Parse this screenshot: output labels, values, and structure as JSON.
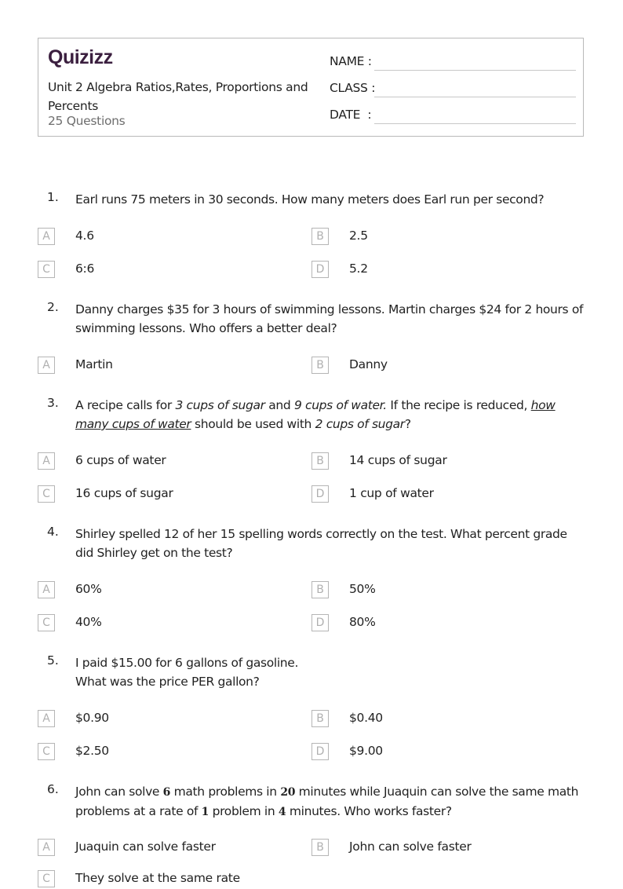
{
  "header": {
    "logo": "Quizizz",
    "title": "Unit 2 Algebra Ratios,Rates, Proportions and Percents",
    "question_count": "25 Questions",
    "fields": [
      {
        "label": "NAME :"
      },
      {
        "label": "CLASS :"
      },
      {
        "label": "DATE  :"
      }
    ]
  },
  "brand_color": "#3b1f3f",
  "questions": [
    {
      "number": "1.",
      "text": "Earl runs 75 meters in 30 seconds. How many meters does Earl run per second?",
      "options": [
        {
          "letter": "A",
          "text": "4.6"
        },
        {
          "letter": "B",
          "text": "2.5"
        },
        {
          "letter": "C",
          "text": "6:6"
        },
        {
          "letter": "D",
          "text": "5.2"
        }
      ]
    },
    {
      "number": "2.",
      "text": "Danny charges $35 for 3 hours of swimming lessons. Martin charges $24 for 2 hours of swimming lessons. Who offers a better deal?",
      "options": [
        {
          "letter": "A",
          "text": "Martin"
        },
        {
          "letter": "B",
          "text": "Danny"
        }
      ]
    },
    {
      "number": "3.",
      "text_parts": [
        {
          "t": "A recipe calls for ",
          "style": "normal"
        },
        {
          "t": "3 cups of sugar",
          "style": "italic"
        },
        {
          "t": " and ",
          "style": "normal"
        },
        {
          "t": "9 cups of water.",
          "style": "italic"
        },
        {
          "t": " If the recipe is reduced, ",
          "style": "normal"
        },
        {
          "t": "how many cups of water",
          "style": "italic-underline"
        },
        {
          "t": " should be used with ",
          "style": "normal"
        },
        {
          "t": "2 cups of sugar",
          "style": "italic"
        },
        {
          "t": "?",
          "style": "normal"
        }
      ],
      "options": [
        {
          "letter": "A",
          "text": "6 cups of water"
        },
        {
          "letter": "B",
          "text": "14 cups of sugar"
        },
        {
          "letter": "C",
          "text": "16 cups of sugar"
        },
        {
          "letter": "D",
          "text": "1 cup of water"
        }
      ]
    },
    {
      "number": "4.",
      "text": " Shirley spelled 12 of her 15 spelling words correctly on the test.  What percent grade did Shirley get on the test?",
      "options": [
        {
          "letter": "A",
          "text": "60%"
        },
        {
          "letter": "B",
          "text": "50%"
        },
        {
          "letter": "C",
          "text": "40%"
        },
        {
          "letter": "D",
          "text": "80%"
        }
      ]
    },
    {
      "number": "5.",
      "text_line1": "I paid $15.00 for 6 gallons of gasoline.",
      "text_line2": "What was the price PER gallon?",
      "options": [
        {
          "letter": "A",
          "text": "$0.90"
        },
        {
          "letter": "B",
          "text": "$0.40"
        },
        {
          "letter": "C",
          "text": "$2.50"
        },
        {
          "letter": "D",
          "text": "$9.00"
        }
      ]
    },
    {
      "number": "6.",
      "text_parts": [
        {
          "t": "John can solve ",
          "style": "normal"
        },
        {
          "t": "6",
          "style": "serifnum"
        },
        {
          "t": " math problems in ",
          "style": "normal"
        },
        {
          "t": "20",
          "style": "serifnum"
        },
        {
          "t": " minutes while Juaquin can solve the same math problems at a rate of ",
          "style": "normal"
        },
        {
          "t": "1",
          "style": "serifnum"
        },
        {
          "t": " problem in ",
          "style": "normal"
        },
        {
          "t": "4",
          "style": "serifnum"
        },
        {
          "t": " minutes. Who works faster?",
          "style": "normal"
        }
      ],
      "options": [
        {
          "letter": "A",
          "text": "Juaquin can solve faster"
        },
        {
          "letter": "B",
          "text": "John can solve faster"
        },
        {
          "letter": "C",
          "text": "They solve at the same rate"
        }
      ]
    }
  ]
}
